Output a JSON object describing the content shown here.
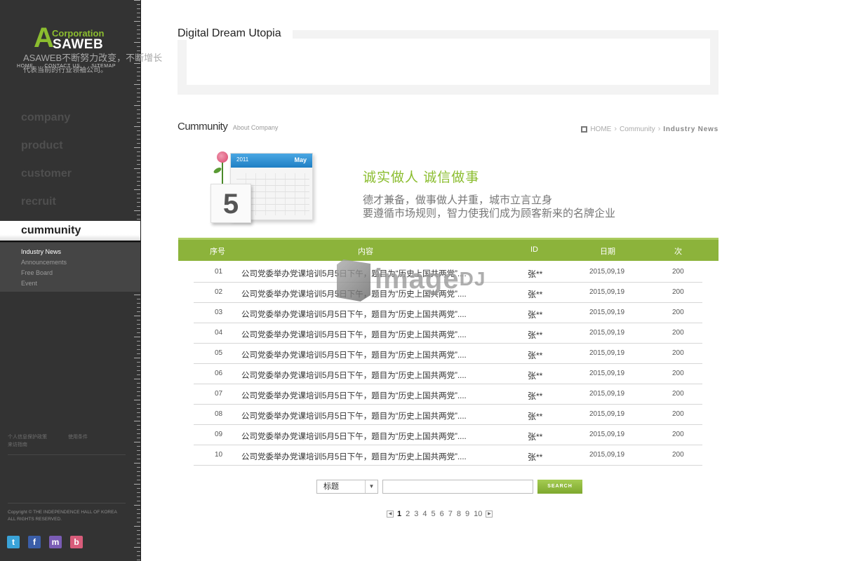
{
  "logo": {
    "letter": "A",
    "corp": "Corporation",
    "name": "SAWEB"
  },
  "top_links": [
    "HOME",
    "CONTACT US",
    "SITEMAP"
  ],
  "nav": [
    {
      "label": "company"
    },
    {
      "label": "product"
    },
    {
      "label": "customer"
    },
    {
      "label": "recruit"
    },
    {
      "label": "cummunity",
      "active": true
    }
  ],
  "sub_nav": [
    {
      "label": "Industry News",
      "active": true
    },
    {
      "label": "Announcements"
    },
    {
      "label": "Free Board"
    },
    {
      "label": "Event"
    }
  ],
  "side_footer": {
    "link1": "个人信息保护政策",
    "link2": "使用条件",
    "link3": "来访指南",
    "copyright1": "Copyright © THE INDEPENDENCE HALL OF KOREA",
    "copyright2": "ALL RIGHTS RESERVED."
  },
  "social": [
    {
      "icon": "twitter-icon",
      "glyph": "t"
    },
    {
      "icon": "facebook-icon",
      "glyph": "f"
    },
    {
      "icon": "me2day-icon",
      "glyph": "m"
    },
    {
      "icon": "blog-icon",
      "glyph": "b"
    }
  ],
  "hero": {
    "title": "Digital Dream Utopia",
    "sub1": "ASAWEB不断努力改变，不断增长",
    "sub2": "代表当前的行业领袖公司。"
  },
  "section": {
    "title": "Cummunity",
    "subtitle": "About Company"
  },
  "breadcrumb": {
    "home": "HOME",
    "mid": "Community",
    "current": "Industry News"
  },
  "calendar": {
    "year": "2011",
    "month": "May",
    "day": "5"
  },
  "motto": {
    "line1": "诚实做人  诚信做事",
    "line2": "德才兼备，做事做人并重，城市立言立身",
    "line3": "要遵循市场规则，智力使我们成为顾客新来的名牌企业"
  },
  "table": {
    "headers": {
      "no": "序号",
      "title": "内容",
      "id": "ID",
      "date": "日期",
      "count": "次"
    },
    "rows": [
      {
        "no": "01",
        "title": "公司党委举办党课培训5月5日下午，题目为“历史上国共两党”....",
        "id": "张**",
        "date": "2015,09,19",
        "count": "200"
      },
      {
        "no": "02",
        "title": "公司党委举办党课培训5月5日下午，题目为“历史上国共两党”....",
        "id": "张**",
        "date": "2015,09,19",
        "count": "200"
      },
      {
        "no": "03",
        "title": "公司党委举办党课培训5月5日下午，题目为“历史上国共两党”....",
        "id": "张**",
        "date": "2015,09,19",
        "count": "200"
      },
      {
        "no": "04",
        "title": "公司党委举办党课培训5月5日下午，题目为“历史上国共两党”....",
        "id": "张**",
        "date": "2015,09,19",
        "count": "200"
      },
      {
        "no": "05",
        "title": "公司党委举办党课培训5月5日下午，题目为“历史上国共两党”....",
        "id": "张**",
        "date": "2015,09,19",
        "count": "200"
      },
      {
        "no": "06",
        "title": "公司党委举办党课培训5月5日下午，题目为“历史上国共两党”....",
        "id": "张**",
        "date": "2015,09,19",
        "count": "200"
      },
      {
        "no": "07",
        "title": "公司党委举办党课培训5月5日下午，题目为“历史上国共两党”....",
        "id": "张**",
        "date": "2015,09,19",
        "count": "200"
      },
      {
        "no": "08",
        "title": "公司党委举办党课培训5月5日下午，题目为“历史上国共两党”....",
        "id": "张**",
        "date": "2015,09,19",
        "count": "200"
      },
      {
        "no": "09",
        "title": "公司党委举办党课培训5月5日下午，题目为“历史上国共两党”....",
        "id": "张**",
        "date": "2015,09,19",
        "count": "200"
      },
      {
        "no": "10",
        "title": "公司党委举办党课培训5月5日下午，题目为“历史上国共两党”....",
        "id": "张**",
        "date": "2015,09,19",
        "count": "200"
      }
    ]
  },
  "search": {
    "select_value": "标题",
    "input_value": "",
    "button_label": "SEARCH"
  },
  "pager": {
    "pages": [
      "1",
      "2",
      "3",
      "4",
      "5",
      "6",
      "7",
      "8",
      "9",
      "10"
    ],
    "current": "1"
  },
  "watermark": {
    "text": "image",
    "suffix": "DJ"
  },
  "colors": {
    "accent": "#8cb33b",
    "sidebar": "#333333"
  }
}
